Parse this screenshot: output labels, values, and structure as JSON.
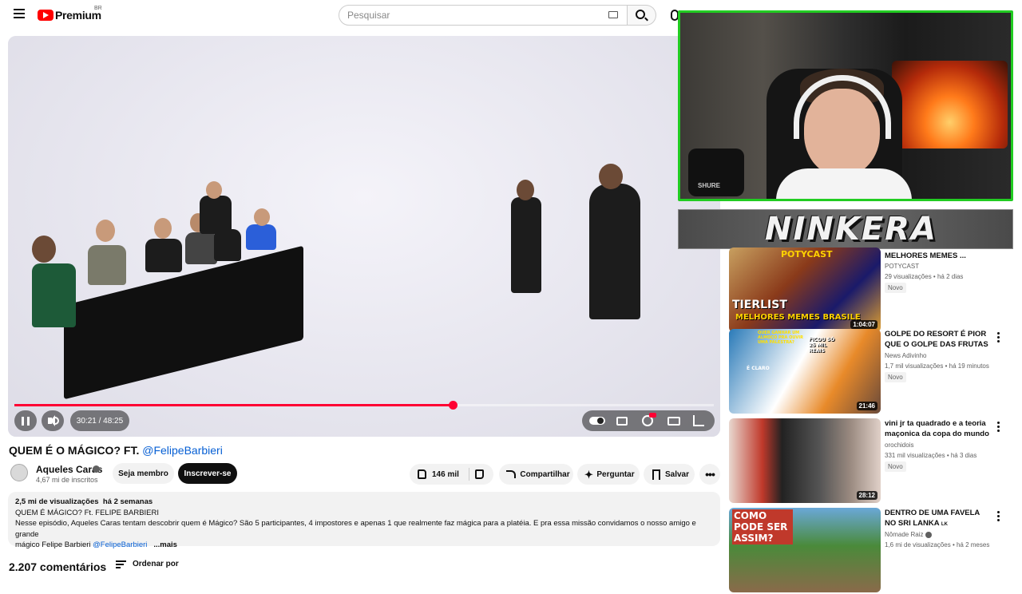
{
  "header": {
    "logo_text": "Premium",
    "country_code": "BR",
    "search_placeholder": "Pesquisar"
  },
  "player": {
    "time_current": "30:21",
    "time_total": "48:25",
    "time_display": "30:21 / 48:25",
    "progress_fraction": 0.627,
    "buffered_fraction": 0.65
  },
  "video": {
    "title_prefix": "QUEM É O MÁGICO? FT.",
    "title_mention": "@FelipeBarbieri",
    "channel": {
      "name": "Aqueles Caras",
      "subscribers": "4,67 mi de inscritos"
    },
    "actions": {
      "member": "Seja membro",
      "subscribe": "Inscrever-se",
      "likes": "146 mil",
      "share": "Compartilhar",
      "ask": "Perguntar",
      "save": "Salvar"
    },
    "description": {
      "views": "2,5 mi de visualizações",
      "date": "há 2 semanas",
      "line1": "QUEM É MÁGICO? Ft. FELIPE BARBIERI",
      "line2": "Nesse episódio, Aqueles Caras tentam descobrir quem é Mágico? São 5 participantes, 4 impostores e apenas 1 que realmente faz mágica para a platéia. E pra essa missão convidamos o nosso amigo e grande",
      "line3_text": "mágico Felipe Barbieri",
      "line3_mention": "@FelipeBarbieri",
      "more": "...mais"
    },
    "comments_count": "2.207 comentários",
    "sort_label": "Ordenar por"
  },
  "overlay": {
    "streamer_name": "NINKERA",
    "mic_brand": "SHURE"
  },
  "recommendations": [
    {
      "title": "MELHORES MEMES ...",
      "channel": "POTYCAST",
      "views": "29 visualizações",
      "age": "há 2 dias",
      "badge": "Novo",
      "duration": "1:04:07",
      "thumb_text_1": "POTYCAST",
      "thumb_text_2": "TIERLIST",
      "thumb_text_3": "MELHORES MEMES BRASILE"
    },
    {
      "title": "GOLPE DO RESORT É PIOR QUE O GOLPE DAS FRUTAS",
      "channel": "News Adivinho",
      "views": "1,7 mil visualizações",
      "age": "há 19 minutos",
      "badge": "Novo",
      "duration": "21:46",
      "thumb_text_1": "FICOU SÓ 25 MIL REAIS",
      "thumb_text_2": "QUER GANHAR UM ALMOÇO PRA OUVIR UMA PALESTRA?",
      "thumb_text_3": "É CLARO"
    },
    {
      "title": "vini jr ta quadrado e a teoria maçonica da copa do mundo",
      "channel": "orochidois",
      "views": "331 mil visualizações",
      "age": "há 3 dias",
      "badge": "Novo",
      "duration": "28:12"
    },
    {
      "title": "DENTRO DE UMA FAVELA NO SRI LANKA",
      "title_suffix": "LK",
      "channel": "Nômade Raiz",
      "views": "1,6 mi de visualizações",
      "age": "há 2 meses",
      "thumb_text_1": "COMO PODE SER ASSIM?"
    }
  ],
  "colors": {
    "accent_red": "#ff0033",
    "link_blue": "#065fd4",
    "webcam_border": "#22cc22"
  }
}
